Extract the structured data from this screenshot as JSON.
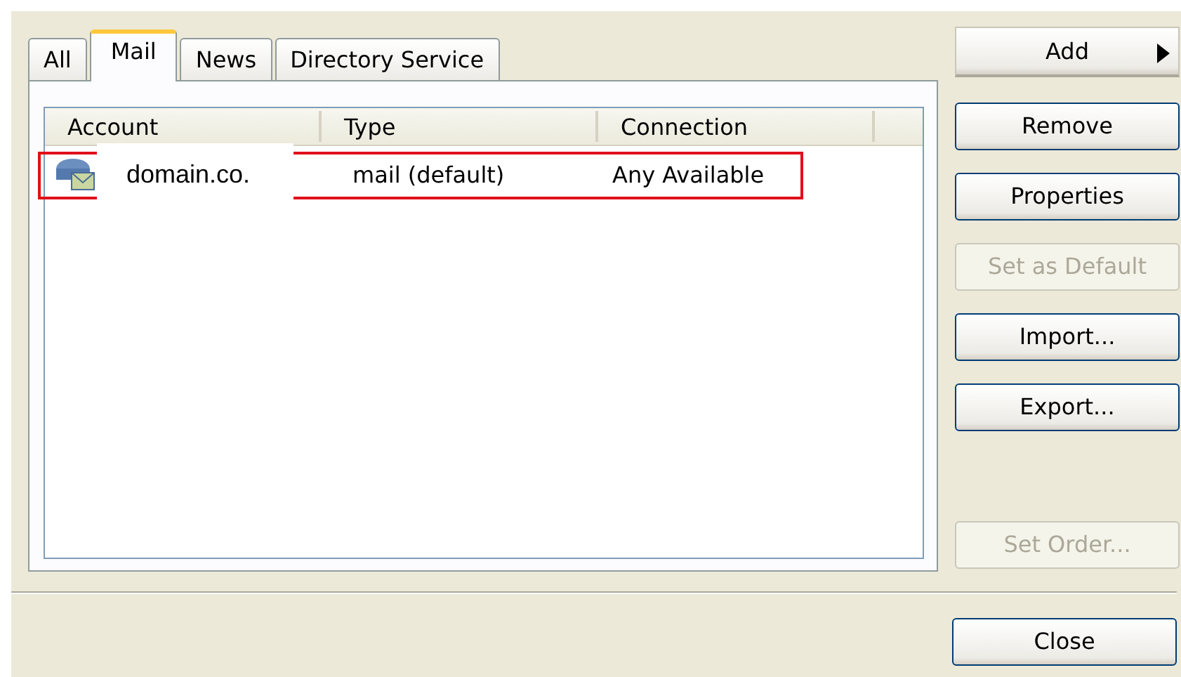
{
  "tabs": [
    {
      "label": "All",
      "selected": false
    },
    {
      "label": "Mail",
      "selected": true
    },
    {
      "label": "News",
      "selected": false
    },
    {
      "label": "Directory Service",
      "selected": false
    }
  ],
  "list": {
    "columns": [
      "Account",
      "Type",
      "Connection"
    ],
    "rows": [
      {
        "account": "domain.co.",
        "type": "mail (default)",
        "connection": "Any Available",
        "highlighted": true
      }
    ]
  },
  "buttons": [
    {
      "label": "Add",
      "kind": "menu",
      "disabled": false
    },
    {
      "label": "Remove",
      "kind": "push",
      "disabled": false
    },
    {
      "label": "Properties",
      "kind": "push",
      "disabled": false
    },
    {
      "label": "Set as Default",
      "kind": "push",
      "disabled": true
    },
    {
      "label": "Import...",
      "kind": "push",
      "disabled": false
    },
    {
      "label": "Export...",
      "kind": "push",
      "disabled": false
    },
    {
      "label": "Set Order...",
      "kind": "push",
      "disabled": true,
      "separated": true
    }
  ],
  "footer_buttons": [
    {
      "label": "Close",
      "disabled": false
    }
  ]
}
